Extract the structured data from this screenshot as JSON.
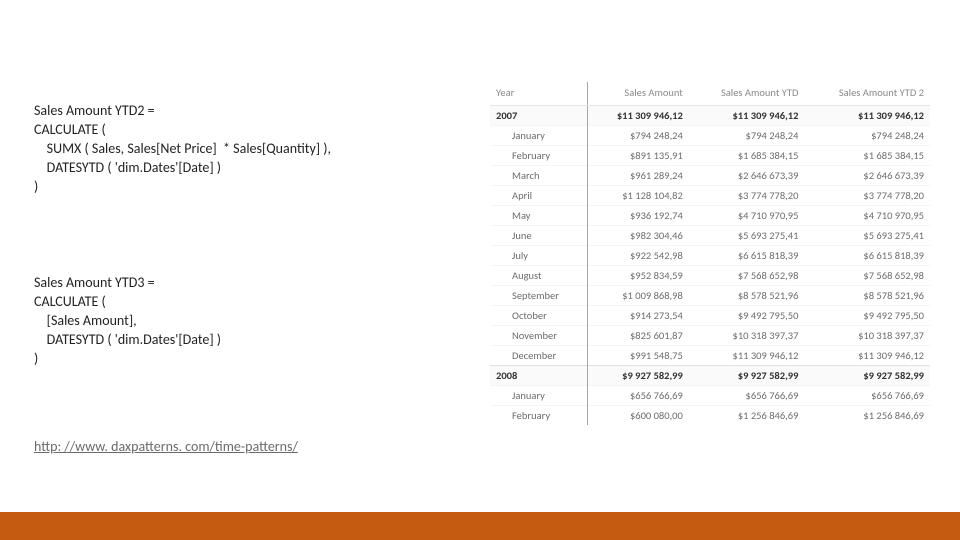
{
  "code1": "Sales Amount YTD2 =\nCALCULATE (\n    SUMX ( Sales, Sales[Net Price]  * Sales[Quantity] ),\n    DATESYTD ( 'dim.Dates'[Date] )\n)",
  "code2": "Sales Amount YTD3 =\nCALCULATE (\n    [Sales Amount],\n    DATESYTD ( 'dim.Dates'[Date] )\n)",
  "link_text": "http: //www. daxpatterns. com/time-patterns/",
  "table": {
    "headers": [
      "Year",
      "Sales Amount",
      "Sales Amount YTD",
      "Sales Amount YTD 2"
    ],
    "rows": [
      {
        "kind": "year",
        "cells": [
          "2007",
          "$11 309 946,12",
          "$11 309 946,12",
          "$11 309 946,12"
        ]
      },
      {
        "kind": "month",
        "cells": [
          "January",
          "$794 248,24",
          "$794 248,24",
          "$794 248,24"
        ]
      },
      {
        "kind": "month",
        "cells": [
          "February",
          "$891 135,91",
          "$1 685 384,15",
          "$1 685 384,15"
        ]
      },
      {
        "kind": "month",
        "cells": [
          "March",
          "$961 289,24",
          "$2 646 673,39",
          "$2 646 673,39"
        ]
      },
      {
        "kind": "month",
        "cells": [
          "April",
          "$1 128 104,82",
          "$3 774 778,20",
          "$3 774 778,20"
        ]
      },
      {
        "kind": "month",
        "cells": [
          "May",
          "$936 192,74",
          "$4 710 970,95",
          "$4 710 970,95"
        ]
      },
      {
        "kind": "month",
        "cells": [
          "June",
          "$982 304,46",
          "$5 693 275,41",
          "$5 693 275,41"
        ]
      },
      {
        "kind": "month",
        "cells": [
          "July",
          "$922 542,98",
          "$6 615 818,39",
          "$6 615 818,39"
        ]
      },
      {
        "kind": "month",
        "cells": [
          "August",
          "$952 834,59",
          "$7 568 652,98",
          "$7 568 652,98"
        ]
      },
      {
        "kind": "month",
        "cells": [
          "September",
          "$1 009 868,98",
          "$8 578 521,96",
          "$8 578 521,96"
        ]
      },
      {
        "kind": "month",
        "cells": [
          "October",
          "$914 273,54",
          "$9 492 795,50",
          "$9 492 795,50"
        ]
      },
      {
        "kind": "month",
        "cells": [
          "November",
          "$825 601,87",
          "$10 318 397,37",
          "$10 318 397,37"
        ]
      },
      {
        "kind": "month",
        "cells": [
          "December",
          "$991 548,75",
          "$11 309 946,12",
          "$11 309 946,12"
        ]
      },
      {
        "kind": "year",
        "cells": [
          "2008",
          "$9 927 582,99",
          "$9 927 582,99",
          "$9 927 582,99"
        ]
      },
      {
        "kind": "month",
        "cells": [
          "January",
          "$656 766,69",
          "$656 766,69",
          "$656 766,69"
        ]
      },
      {
        "kind": "month",
        "cells": [
          "February",
          "$600 080,00",
          "$1 256 846,69",
          "$1 256 846,69"
        ]
      }
    ]
  }
}
